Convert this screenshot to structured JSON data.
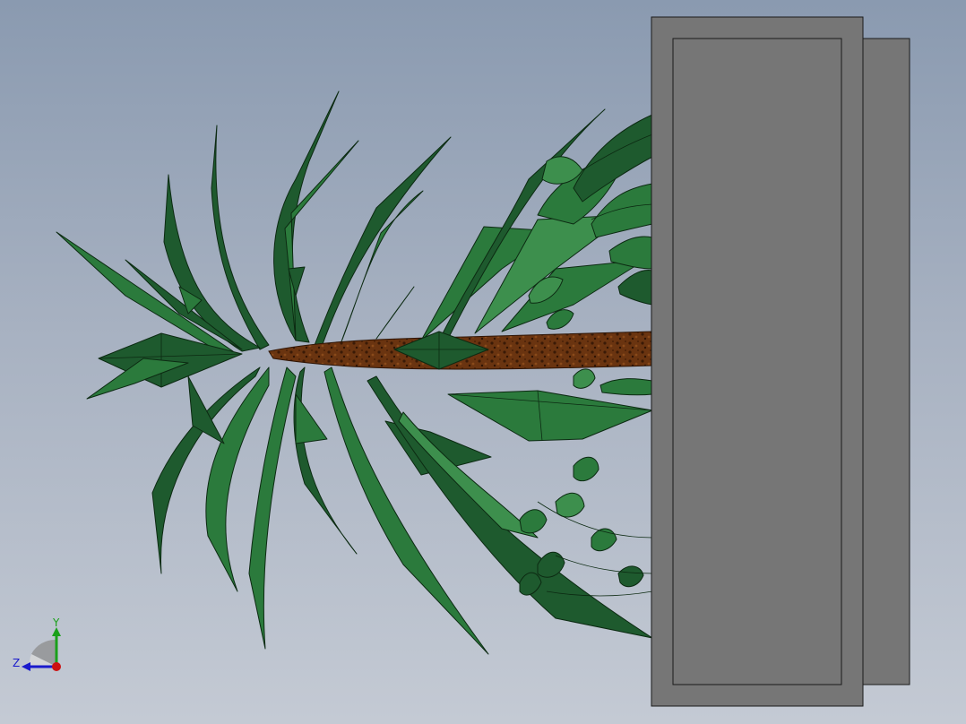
{
  "viewport": {
    "background_top": "#8a9ab0",
    "background_bottom": "#c4cad4"
  },
  "model": {
    "planter_color": "#767676",
    "planter_edge": "#1a1a1a",
    "trunk_color": "#6a3410",
    "leaf_dark": "#1e5a2e",
    "leaf_mid": "#2b7a3c",
    "leaf_light": "#3d8f4d"
  },
  "triad": {
    "y_label": "Y",
    "z_label": "Z",
    "y_color": "#1aa01a",
    "z_color": "#1a1acc",
    "x_color": "#cc1010"
  }
}
